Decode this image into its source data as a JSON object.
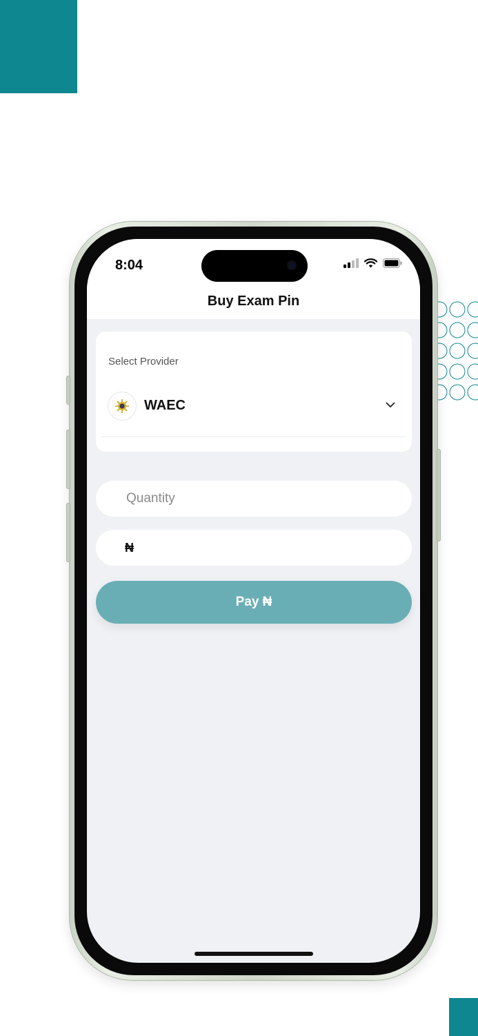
{
  "status_bar": {
    "time": "8:04"
  },
  "header": {
    "title": "Buy Exam Pin"
  },
  "provider": {
    "label": "Select Provider",
    "selected": "WAEC",
    "logo_icon": "waec-logo-icon"
  },
  "quantity": {
    "placeholder": "Quantity",
    "value": ""
  },
  "amount": {
    "currency_symbol": "₦"
  },
  "pay": {
    "label": "Pay ₦"
  },
  "colors": {
    "brand_teal": "#0f8790",
    "pay_button": "#6aaeb5",
    "background": "#f0f1f5"
  }
}
